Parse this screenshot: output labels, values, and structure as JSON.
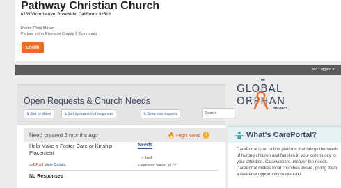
{
  "header": {
    "church_name": "Pathway Christian Church",
    "address": "6755 Victoria Ave, Riverside, California 92516",
    "pastor": "Pastor Chris Mason",
    "partner": "Partner in the Riverside County 2 Community",
    "login_label": "LOGIN"
  },
  "status_bar": {
    "text": "Not Logged In"
  },
  "requests": {
    "title": "Open Requests & Church Needs",
    "sort_oldest": "Sort by oldest",
    "sort_responses": "Sort by lowest # of responses",
    "show_less": "Show less requests",
    "search_placeholder": "Search",
    "need": {
      "created": "Need created 2 months ago",
      "priority": "High Need",
      "title": "Help Make a Foster Care or Kinship Placement",
      "id": "asDFsdf",
      "view_details": "View Details",
      "needs_label": "Needs",
      "items": [
        "bed"
      ],
      "estimated_value": "Estimated Value: $122",
      "responses": "No Responses"
    }
  },
  "logo": {
    "the": "THE",
    "global": "GLOBAL",
    "orphan": "ORPHAN",
    "project": "PROJECT"
  },
  "careportal": {
    "title": "What's CarePortal?",
    "body": "CarePortal is an online platform that brings the needs of hurting children and families in your community to your attention. Caseworkers uncover the needs. CarePortal makes local churches aware, giving them a real-time opportunity to respond."
  },
  "colors": {
    "accent": "#f06a1f",
    "link": "#2b5a9c",
    "heading": "#3c4a63",
    "status_bar": "#5c5c5c"
  },
  "icons": {
    "sort": "sort-icon",
    "priority": "flame-icon",
    "warning": "warning-icon",
    "info": "person-info-icon"
  }
}
